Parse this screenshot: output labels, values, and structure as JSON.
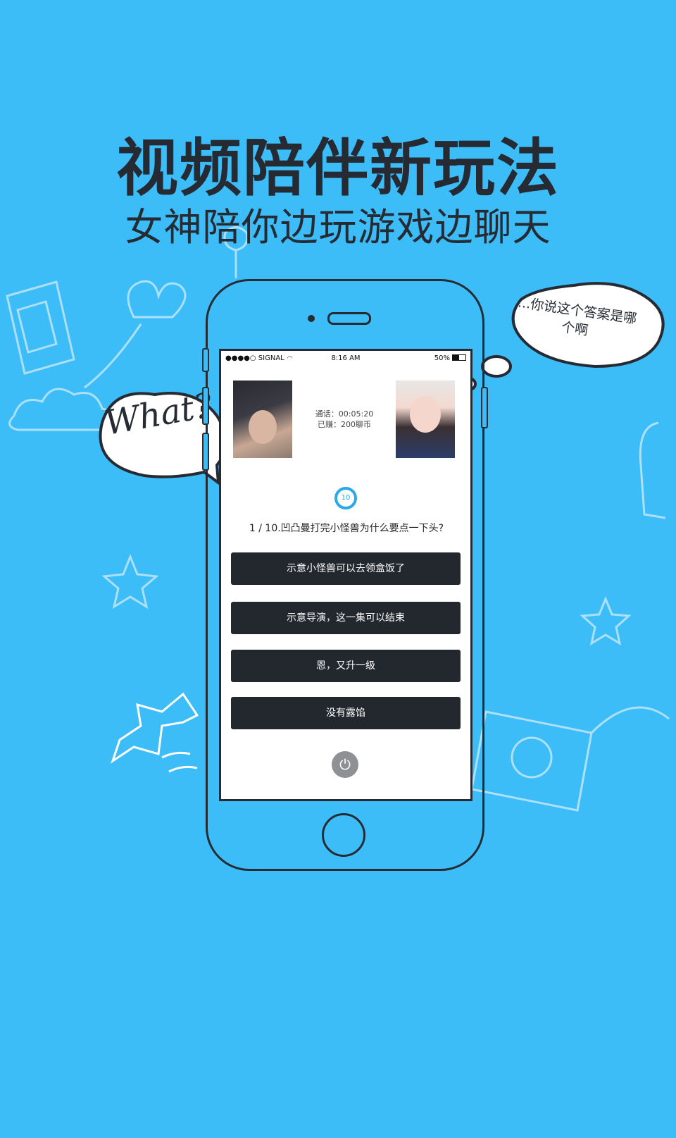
{
  "poster": {
    "title": "视频陪伴新玩法",
    "subtitle": "女神陪你边玩游戏边聊天"
  },
  "phone": {
    "status_bar": {
      "carrier": "●●●●○ SIGNAL",
      "time": "8:16 AM",
      "battery": "50%"
    },
    "call": {
      "duration": "通话：00:05:20",
      "earned": "已赚：200聊币"
    },
    "timer": "10",
    "quiz": {
      "question": "1 / 10.凹凸曼打完小怪兽为什么要点一下头?",
      "options": [
        "示意小怪兽可以去领盒饭了",
        "示意导演，这一集可以结束",
        "恩，又升一级",
        "没有露馅"
      ]
    }
  },
  "bubbles": {
    "left": "What?",
    "right": "...你说这个答案是哪个啊"
  },
  "colors": {
    "background": "#3dbdf8",
    "ink": "#262b33",
    "button": "#23272e",
    "accent": "#2aa8ec"
  }
}
